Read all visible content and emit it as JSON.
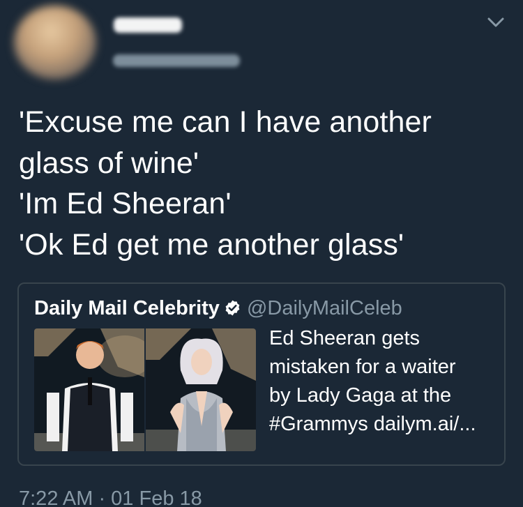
{
  "author": {
    "avatar": "blurred-avatar",
    "display_name_blurred": true,
    "handle_blurred": true
  },
  "menu_icon": "chevron-down-icon",
  "tweet": {
    "lines": [
      "'Excuse me can I have another",
      "glass of wine'",
      "'Im Ed Sheeran'",
      "'Ok Ed get me another glass'"
    ]
  },
  "quoted_tweet": {
    "name": "Daily Mail Celebrity",
    "verified_icon": "verified-badge-icon",
    "handle": "@DailyMailCeleb",
    "text_lines": [
      "Ed Sheeran gets",
      "mistaken for a waiter",
      "by Lady Gaga at the",
      "#Grammys dailym.ai/..."
    ],
    "media": "photo-ed-sheeran-and-lady-gaga-at-grammys"
  },
  "timestamp": "7:22 AM · 01 Feb 18",
  "colors": {
    "background": "#1b2836",
    "text": "#ffffff",
    "secondary": "#8899a6",
    "border": "#38444d"
  }
}
